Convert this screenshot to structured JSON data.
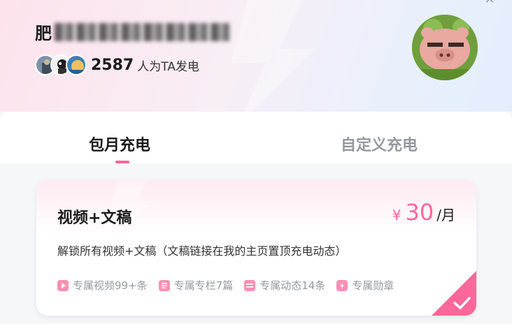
{
  "header": {
    "name_visible": "肥",
    "supporter_count": "2587",
    "supporter_label": "人为TA发电"
  },
  "tabs": [
    {
      "label": "包月充电"
    },
    {
      "label": "自定义充电"
    }
  ],
  "plan": {
    "title": "视频+文稿",
    "currency": "¥",
    "price": "30",
    "unit": "/月",
    "description": "解锁所有视频+文稿（文稿链接在我的主页置顶充电动态）",
    "perks": [
      {
        "label": "专属视频99+条",
        "icon": "video-icon"
      },
      {
        "label": "专属专栏7篇",
        "icon": "article-icon"
      },
      {
        "label": "专属动态14条",
        "icon": "post-icon"
      },
      {
        "label": "专属勋章",
        "icon": "badge-icon"
      }
    ]
  },
  "colors": {
    "accent": "#ff6699",
    "muted": "#9499a0"
  }
}
